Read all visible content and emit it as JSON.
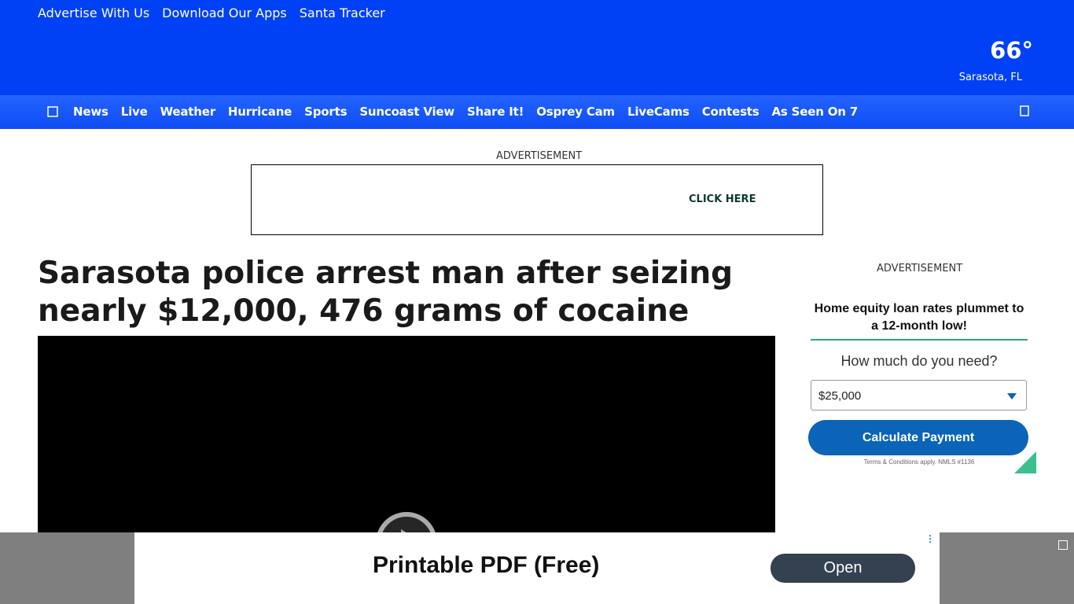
{
  "top_links": [
    "Advertise With Us",
    "Download Our Apps",
    "Santa Tracker"
  ],
  "weather": {
    "temperature": "66°",
    "location": "Sarasota, FL"
  },
  "nav": {
    "items": [
      "News",
      "Live",
      "Weather",
      "Hurricane",
      "Sports",
      "Suncoast View",
      "Share It!",
      "Osprey Cam",
      "LiveCams",
      "Contests",
      "As Seen On 7"
    ],
    "menu_icon": "menu-icon",
    "search_icon": "search-icon"
  },
  "banner_ad": {
    "label": "ADVERTISEMENT",
    "cta": "CLICK HERE"
  },
  "article": {
    "headline": "Sarasota police arrest man after seizing nearly $12,000, 476 grams of cocaine"
  },
  "side_ad": {
    "label": "ADVERTISEMENT",
    "heading": "Home equity loan rates plummet to a 12-month low!",
    "question": "How much do you need?",
    "amount": "$25,000",
    "button": "Calculate Payment",
    "terms": "Terms & Conditions apply. NMLS #1136"
  },
  "bottom_ad": {
    "title": "Printable PDF (Free)",
    "button": "Open"
  },
  "colors": {
    "brand_blue": "#0041f5",
    "nav_blue": "#1552f7",
    "ad_button_blue": "#0b64b8",
    "ad_accent_green": "#2ea87e"
  }
}
